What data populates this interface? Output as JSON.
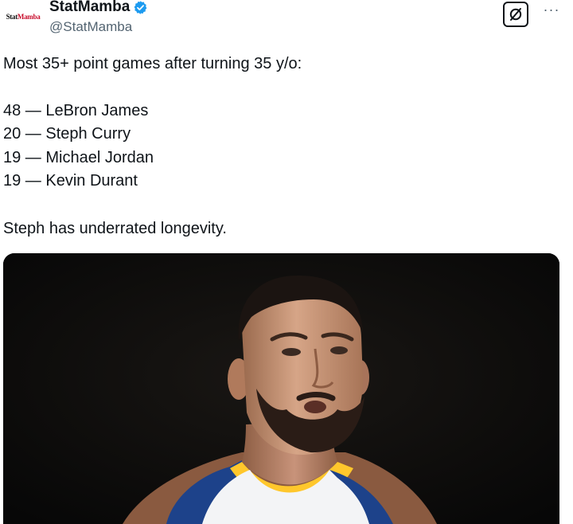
{
  "author": {
    "logo_text_a": "Stat",
    "logo_text_b": "Mamba",
    "display_name": "StatMamba",
    "handle": "@StatMamba",
    "verified_color": "#1d9bf0"
  },
  "actions": {
    "grok_icon": "grok-icon",
    "more_label": "···"
  },
  "tweet": {
    "lines": [
      "Most 35+ point games after turning 35 y/o:",
      "48 — LeBron James",
      "20 — Steph Curry",
      "19 — Michael Jordan",
      "19 — Kevin Durant",
      "Steph has underrated longevity."
    ]
  },
  "media": {
    "subject": "basketball player photo",
    "jersey_colors": [
      "#ffffff",
      "#1d428a",
      "#ffc72c"
    ]
  }
}
